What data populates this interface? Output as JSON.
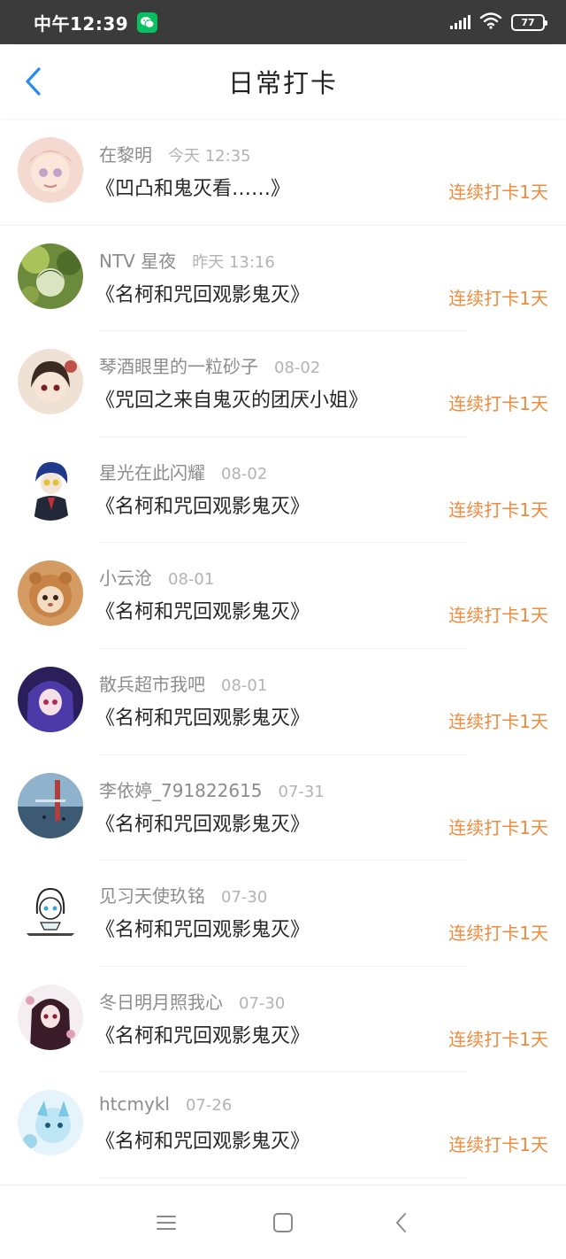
{
  "status_bar": {
    "time": "中午12:39",
    "battery": "77"
  },
  "header": {
    "title": "日常打卡"
  },
  "entries": [
    {
      "username": "在黎明",
      "time": "今天 12:35",
      "title": "《凹凸和鬼灭看……》",
      "streak": "连续打卡1天"
    },
    {
      "username": "NTV 星夜",
      "time": "昨天 13:16",
      "title": "《名柯和咒回观影鬼灭》",
      "streak": "连续打卡1天"
    },
    {
      "username": "琴酒眼里的一粒砂子",
      "time": "08-02",
      "title": "《咒回之来自鬼灭的团厌小姐》",
      "streak": "连续打卡1天"
    },
    {
      "username": "星光在此闪耀",
      "time": "08-02",
      "title": "《名柯和咒回观影鬼灭》",
      "streak": "连续打卡1天"
    },
    {
      "username": "小云沧",
      "time": "08-01",
      "title": "《名柯和咒回观影鬼灭》",
      "streak": "连续打卡1天"
    },
    {
      "username": "散兵超市我吧",
      "time": "08-01",
      "title": "《名柯和咒回观影鬼灭》",
      "streak": "连续打卡1天"
    },
    {
      "username": "李依婷_791822615",
      "time": "07-31",
      "title": "《名柯和咒回观影鬼灭》",
      "streak": "连续打卡1天"
    },
    {
      "username": "见习天使玖铭",
      "time": "07-30",
      "title": "《名柯和咒回观影鬼灭》",
      "streak": "连续打卡1天"
    },
    {
      "username": "冬日明月照我心",
      "time": "07-30",
      "title": "《名柯和咒回观影鬼灭》",
      "streak": "连续打卡1天"
    },
    {
      "username": "htcmykl",
      "time": "07-26",
      "title": "《名柯和咒回观影鬼灭》",
      "streak": "连续打卡1天"
    }
  ],
  "icons": {
    "back": "chevron-left-icon",
    "nav_menu": "menu-icon",
    "nav_home": "home-square-icon",
    "nav_back": "back-triangle-icon"
  },
  "colors": {
    "accent_blue": "#2b8cf0",
    "streak_orange": "#f08a3c",
    "status_bar_bg": "#3b3b3b"
  }
}
